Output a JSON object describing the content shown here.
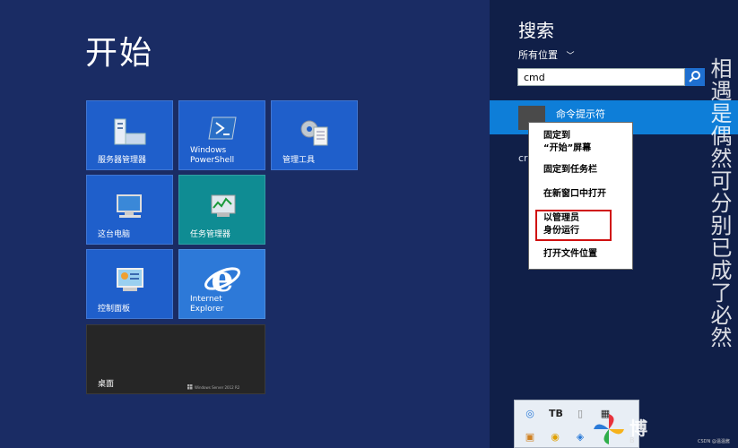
{
  "start": {
    "title": "开始",
    "tiles": [
      {
        "label": "服务器管理器"
      },
      {
        "label": "Windows\nPowerShell"
      },
      {
        "label": "管理工具"
      },
      {
        "label": "这台电脑"
      },
      {
        "label": "任务管理器"
      },
      {
        "label": "控制面板"
      },
      {
        "label": "Internet\nExplorer"
      },
      {
        "label": "桌面",
        "sub": "Windows Server 2012 R2"
      }
    ]
  },
  "search": {
    "title": "搜索",
    "scope": "所有位置",
    "query": "cmd",
    "result_label": "命令提示符",
    "secondary_text": "cr"
  },
  "context_menu": {
    "items": [
      "固定到\n“开始”屏幕",
      "固定到任务栏",
      "在新窗口中打开",
      "以管理员\n身份运行",
      "打开文件位置"
    ]
  },
  "watermark": {
    "vertical_text": "相遇是偶然可分别已成了必然",
    "logo_text": "博",
    "logo_small": "B",
    "csdn": "CSDN @温温酱"
  },
  "colors": {
    "start_bg": "#1a2c64",
    "tile_blue": "#1f5fcb",
    "tile_teal": "#0f8c93",
    "search_bg": "#101f48",
    "result_selected": "#0e7ed8",
    "highlight_border": "#d01010"
  }
}
